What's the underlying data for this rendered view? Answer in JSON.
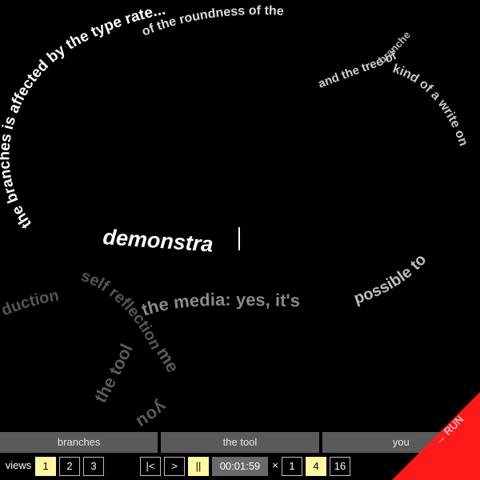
{
  "canvas": {
    "phrases": [
      {
        "id": "main",
        "text": "the branches is affected by the type rate...",
        "color": "#ffffff"
      },
      {
        "id": "typing",
        "text": "demonstra",
        "color": "#ffffff"
      },
      {
        "id": "inner",
        "text": "of the roundness of the",
        "color": "#dcdcdc"
      },
      {
        "id": "tree",
        "text": "and the tree of",
        "color": "#d0d0d0"
      },
      {
        "id": "kind",
        "text": "kind of a write on",
        "color": "#c8c8c8"
      },
      {
        "id": "media",
        "text": "possible to",
        "color": "#bdbdbd"
      },
      {
        "id": "media2",
        "text": "the media: yes, it's",
        "color": "#8a8a8a"
      },
      {
        "id": "branches_word",
        "text": "branches",
        "color": "#bdbdbd"
      },
      {
        "id": "duction",
        "text": "duction",
        "color": "#555555"
      },
      {
        "id": "selfref",
        "text": "self reflection",
        "color": "#555555"
      },
      {
        "id": "thetool",
        "text": "the tool",
        "color": "#5a5a5a"
      },
      {
        "id": "me",
        "text": "me",
        "color": "#5a5a5a"
      },
      {
        "id": "you",
        "text": "you",
        "color": "#5a5a5a"
      }
    ]
  },
  "tabs": [
    {
      "label": "branches"
    },
    {
      "label": "the tool"
    },
    {
      "label": "you"
    }
  ],
  "controls": {
    "views_label": "views",
    "views": [
      "1",
      "2",
      "3"
    ],
    "active_view": "1",
    "nav": [
      "|<",
      ">",
      "||"
    ],
    "time": "00:01:59",
    "speed_label": "×",
    "speeds": [
      "1",
      "4",
      "16"
    ],
    "active_speed": "4",
    "run": "→ RUN"
  },
  "colors": {
    "accent": "#fff8a0",
    "run": "#ff1a1a",
    "tab": "#5a5a5a"
  }
}
